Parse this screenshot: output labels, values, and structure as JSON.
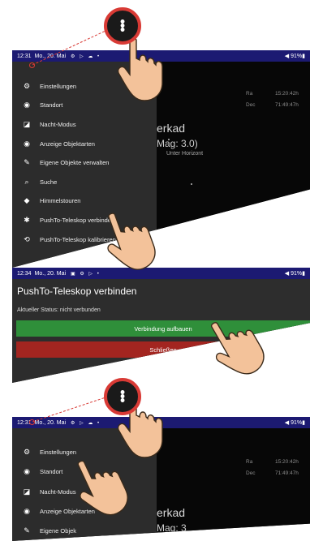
{
  "panel1": {
    "status_time": "12:31",
    "status_date": "Mo., 20. Mai",
    "status_icons": "⚙ ▷ ☁ •",
    "status_battery": "◀ 91%▮",
    "menu": [
      {
        "icon": "⚙",
        "label": "Einstellungen"
      },
      {
        "icon": "◉",
        "label": "Standort"
      },
      {
        "icon": "◪",
        "label": "Nacht-Modus"
      },
      {
        "icon": "◉",
        "label": "Anzeige Objektarten"
      },
      {
        "icon": "✎",
        "label": "Eigene Objekte verwalten"
      },
      {
        "icon": "⌕",
        "label": "Suche"
      },
      {
        "icon": "◆",
        "label": "Himmelstouren"
      },
      {
        "icon": "✱",
        "label": "PushTo-Teleskop verbinden"
      },
      {
        "icon": "⟲",
        "label": "PushTo-Teleskop kalibrieren"
      }
    ],
    "starmap": {
      "ra_label": "Ra",
      "ra_value": "15:20:42h",
      "dec_label": "Dec",
      "dec_value": "71:49:47h",
      "star_name": "erkad",
      "star_mag": "Mag: 3.0)",
      "horizon_label": "Unter Horizont"
    }
  },
  "panel2": {
    "status_time": "12:34",
    "status_date": "Mo., 20. Mai",
    "status_icons": "▣ ⚙ ▷ •",
    "status_battery": "◀ 91%▮",
    "dialog_title": "PushTo-Teleskop verbinden",
    "status_text": "Aktueller Status: nicht verbunden",
    "connect_button": "Verbindung aufbauen",
    "close_button": "Schließen"
  },
  "panel3": {
    "status_time": "12:31",
    "status_date": "Mo., 20. Mai",
    "status_icons": "⚙ ▷ ☁ •",
    "status_battery": "◀ 91%▮",
    "menu": [
      {
        "icon": "⚙",
        "label": "Einstellungen"
      },
      {
        "icon": "◉",
        "label": "Standort"
      },
      {
        "icon": "◪",
        "label": "Nacht-Modus"
      },
      {
        "icon": "◉",
        "label": "Anzeige Objektarten"
      },
      {
        "icon": "✎",
        "label": "Eigene Objek"
      }
    ],
    "starmap": {
      "ra_label": "Ra",
      "ra_value": "15:20:42h",
      "dec_label": "Dec",
      "dec_value": "71:49:47h",
      "star_name": "erkad",
      "star_mag": "Mag: 3"
    }
  },
  "overlay": {
    "menu_icon": "⋮",
    "accent_color": "#d83a35",
    "hand_color": "#f3c29a"
  }
}
